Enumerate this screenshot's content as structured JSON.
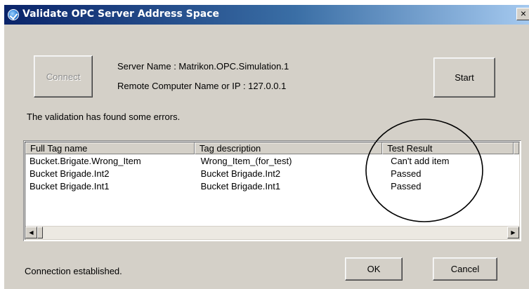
{
  "window": {
    "title": "Validate OPC Server Address Space",
    "close_glyph": "×"
  },
  "buttons": {
    "connect": "Connect",
    "start": "Start",
    "ok": "OK",
    "cancel": "Cancel"
  },
  "server": {
    "name_line": "Server Name : Matrikon.OPC.Simulation.1",
    "remote_line": "Remote Computer Name or IP :  127.0.0.1"
  },
  "validation_message": "The validation has found some errors.",
  "table": {
    "columns": [
      "Full Tag name",
      "Tag description",
      "Test Result"
    ],
    "rows": [
      [
        "Bucket.Brigate.Wrong_Item",
        "Wrong_Item_(for_test)",
        "Can't add item"
      ],
      [
        "Bucket Brigade.Int2",
        "Bucket Brigade.Int2",
        "Passed"
      ],
      [
        "Bucket Brigade.Int1",
        "Bucket Brigade.Int1",
        "Passed"
      ]
    ]
  },
  "scrollbar": {
    "left_arrow": "◀",
    "right_arrow": "▶"
  },
  "status": "Connection established.",
  "colors": {
    "titlebar_start": "#0a246a",
    "titlebar_end": "#a6caf0",
    "dialog_bg": "#d4d0c8",
    "annotation": "#000000"
  }
}
